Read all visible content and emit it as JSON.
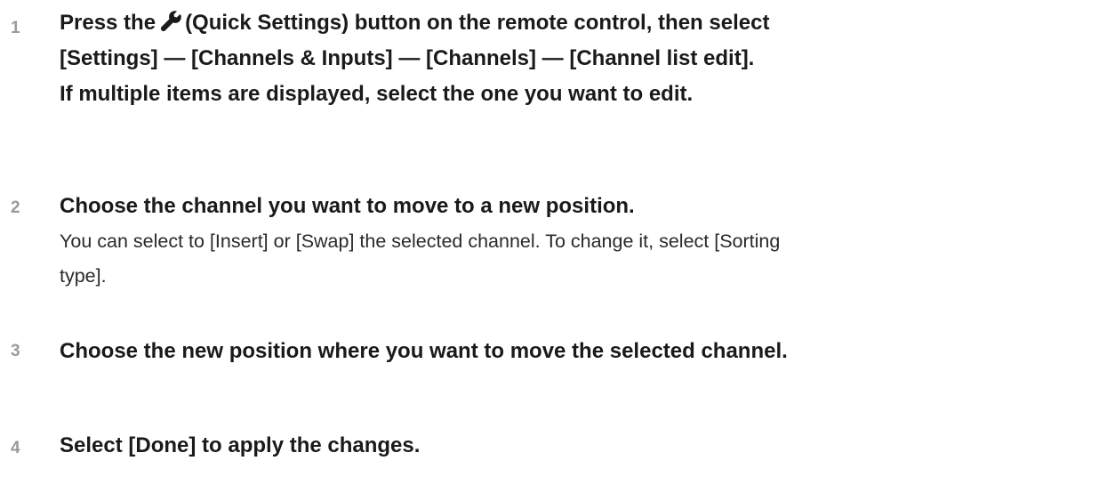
{
  "steps": [
    {
      "number": "1",
      "lines": {
        "l1_before": "Press the",
        "l1_after": "(Quick Settings) button on the remote control, then select",
        "l2": "[Settings] — [Channels & Inputs] — [Channels] — [Channel list edit].",
        "l3": "If multiple items are displayed, select the one you want to edit."
      },
      "icon": "wrench-icon"
    },
    {
      "number": "2",
      "title": "Choose the channel you want to move to a new position.",
      "desc_l1": "You can select to [Insert] or [Swap] the selected channel. To change it, select [Sorting",
      "desc_l2": "type]."
    },
    {
      "number": "3",
      "title": "Choose the new position where you want to move the selected channel."
    },
    {
      "number": "4",
      "title": "Select [Done] to apply the changes."
    }
  ]
}
